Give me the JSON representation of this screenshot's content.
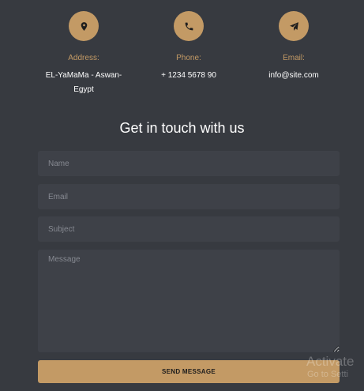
{
  "colors": {
    "accent": "#c39a65",
    "background": "#373a40",
    "field_background": "#3e4148"
  },
  "contact_info": {
    "address": {
      "icon": "map-pin-icon",
      "label": "Address:",
      "value": "EL-YaMaMa - Aswan-Egypt"
    },
    "phone": {
      "icon": "phone-icon",
      "label": "Phone:",
      "value": "+ 1234 5678 90"
    },
    "email": {
      "icon": "paper-plane-icon",
      "label": "Email:",
      "value": "info@site.com"
    }
  },
  "form": {
    "heading": "Get in touch with us",
    "name_placeholder": "Name",
    "email_placeholder": "Email",
    "subject_placeholder": "Subject",
    "message_placeholder": "Message",
    "submit_label": "SEND MESSAGE"
  },
  "watermark": {
    "line1": "Activate",
    "line2": "Go to Setti"
  }
}
